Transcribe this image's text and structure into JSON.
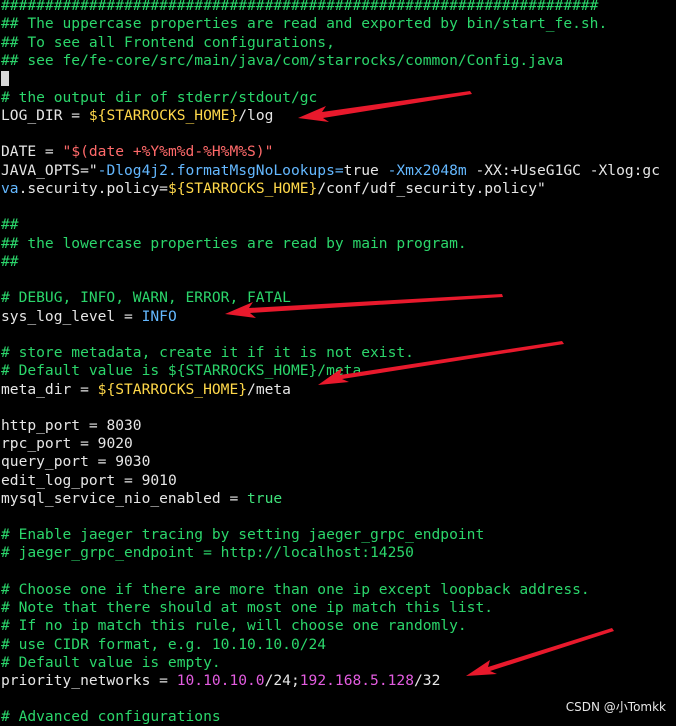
{
  "editor": {
    "header": {
      "hashes": "####################################################################",
      "c1": "## The uppercase properties are read and exported by bin/start_fe.sh.",
      "c2": "## To see all Frontend configurations,",
      "c3": "## see fe/fe-core/src/main/java/com/starrocks/common/Config.java"
    },
    "log": {
      "comment": "# the output dir of stderr/stdout/gc",
      "key": "LOG_DIR = ",
      "var": "${STARROCKS_HOME}",
      "suffix": "/log"
    },
    "date": {
      "key": "DATE = ",
      "open": "\"",
      "expr": "$(date +%Y%m%d-%H%M%S)",
      "close": "\""
    },
    "java_opts": {
      "key": "JAVA_OPTS=\"",
      "o1": "-Dlog4j2.formatMsgNoLookups=",
      "true": "true",
      "o2": " -Xmx2048m",
      "o3": " -XX:+UseG1GC -Xlog:gc",
      "wrap": "va",
      "o4": ".security.policy=",
      "var": "${STARROCKS_HOME}",
      "o5": "/conf/udf_security.policy\""
    },
    "lower": {
      "l1": "##",
      "l2": "## the lowercase properties are read by main program.",
      "l3": "##"
    },
    "sys_log": {
      "comment": "# DEBUG, INFO, WARN, ERROR, FATAL",
      "key": "sys_log_level = ",
      "value": "INFO"
    },
    "meta": {
      "c1": "# store metadata, create it if it is not exist.",
      "c2": "# Default value is ${STARROCKS_HOME}/meta",
      "key": "meta_dir = ",
      "var": "${STARROCKS_HOME}",
      "suffix": "/meta"
    },
    "ports": [
      {
        "key": "http_port = ",
        "value": "8030"
      },
      {
        "key": "rpc_port = ",
        "value": "9020"
      },
      {
        "key": "query_port = ",
        "value": "9030"
      },
      {
        "key": "edit_log_port = ",
        "value": "9010"
      }
    ],
    "mysql_nio": {
      "key": "mysql_service_nio_enabled = ",
      "value": "true"
    },
    "jaeger": {
      "c1": "# Enable jaeger tracing by setting jaeger_grpc_endpoint",
      "c2": "# jaeger_grpc_endpoint = http://localhost:14250"
    },
    "priority": {
      "c1": "# Choose one if there are more than one ip except loopback address.",
      "c2": "# Note that there should at most one ip match this list.",
      "c3": "# If no ip match this rule, will choose one randomly.",
      "c4": "# use CIDR format, e.g. 10.10.10.0/24",
      "c5": "# Default value is empty.",
      "key": "priority_networks = ",
      "ip1": "10.10.10.0",
      "m1": "/24;",
      "ip2": "192.168.5.128",
      "m2": "/32"
    },
    "advanced": "# Advanced configurations"
  },
  "watermark": "CSDN @小Tomkk",
  "colors": {
    "background": "#000000",
    "comment": "#2bd66b",
    "variable": "#ffd84a",
    "string": "#ff6a6a",
    "keyword": "#64b8ff",
    "ip": "#e35ce0",
    "arrow": "#e8192c"
  }
}
